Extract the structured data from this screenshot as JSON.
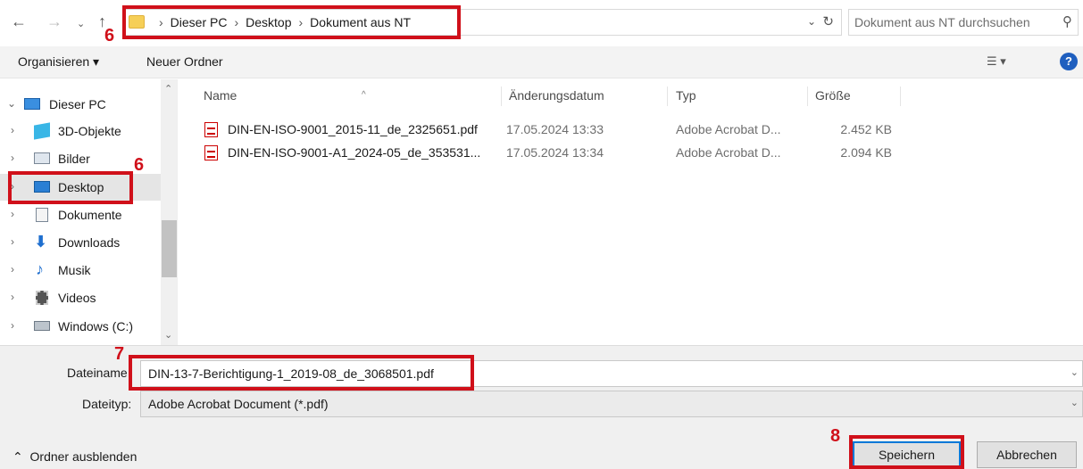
{
  "nav": {
    "back_icon": "arrow-left-icon",
    "forward_icon": "arrow-right-icon",
    "recent_icon": "chevron-down-icon",
    "up_icon": "arrow-up-icon"
  },
  "address": {
    "crumbs": [
      "Dieser PC",
      "Desktop",
      "Dokument aus NT"
    ]
  },
  "search": {
    "placeholder": "Dokument aus NT durchsuchen"
  },
  "toolbar": {
    "organize": "Organisieren ▾",
    "new_folder": "Neuer Ordner"
  },
  "sidebar": {
    "items": [
      {
        "label": "Dieser PC",
        "icon": "computer-icon"
      },
      {
        "label": "3D-Objekte",
        "icon": "cube-icon"
      },
      {
        "label": "Bilder",
        "icon": "image-icon"
      },
      {
        "label": "Desktop",
        "icon": "desktop-icon",
        "selected": true
      },
      {
        "label": "Dokumente",
        "icon": "document-icon"
      },
      {
        "label": "Downloads",
        "icon": "download-icon"
      },
      {
        "label": "Musik",
        "icon": "music-icon"
      },
      {
        "label": "Videos",
        "icon": "video-icon"
      },
      {
        "label": "Windows (C:)",
        "icon": "drive-icon"
      }
    ]
  },
  "list": {
    "columns": [
      "Name",
      "Änderungsdatum",
      "Typ",
      "Größe"
    ],
    "rows": [
      {
        "name": "DIN-EN-ISO-9001_2015-11_de_2325651.pdf",
        "date": "17.05.2024 13:33",
        "type": "Adobe Acrobat D...",
        "size": "2.452 KB"
      },
      {
        "name": "DIN-EN-ISO-9001-A1_2024-05_de_353531...",
        "date": "17.05.2024 13:34",
        "type": "Adobe Acrobat D...",
        "size": "2.094 KB"
      }
    ]
  },
  "form": {
    "filename_label": "Dateiname:",
    "filename_value": "DIN-13-7-Berichtigung-1_2019-08_de_3068501.pdf",
    "filetype_label": "Dateityp:",
    "filetype_value": "Adobe Acrobat Document (*.pdf)",
    "hide_folders": "Ordner ausblenden",
    "save": "Speichern",
    "cancel": "Abbrechen"
  },
  "annotations": {
    "address_step": "6",
    "desktop_step": "6",
    "filename_step": "7",
    "save_step": "8",
    "color": "#d0101a"
  }
}
